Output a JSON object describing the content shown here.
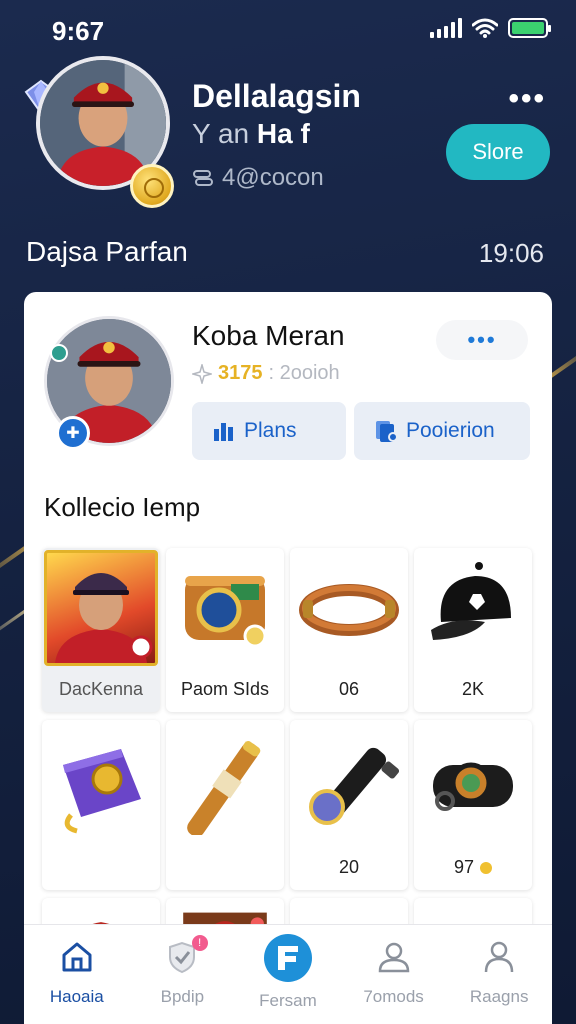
{
  "status_bar": {
    "time": "9:67"
  },
  "header": {
    "name": "Dellalagsin",
    "subtitle_prefix": "Y an",
    "subtitle_bold": "Ha f",
    "meta": "4@cocon",
    "store_label": "Slore",
    "more_label": "•••"
  },
  "section": {
    "title": "Dajsa Parfan",
    "count": "19:06"
  },
  "card": {
    "name": "Koba Meran",
    "meta_gold": "3175",
    "meta_rest": ": 2ooioh",
    "more_label": "•••",
    "plans_label": "Plans",
    "position_label": "Pooierion",
    "collection_title": "Kollecio Iemp"
  },
  "items": [
    {
      "label": "DacKenna",
      "icon": "player-card-icon",
      "selected": true
    },
    {
      "label": "Paom SIds",
      "icon": "wrist-band-icon"
    },
    {
      "label": "06",
      "icon": "leather-ring-icon"
    },
    {
      "label": "2K",
      "icon": "baseball-cap-icon"
    },
    {
      "label": "",
      "icon": "purple-arm-guard-icon"
    },
    {
      "label": "",
      "icon": "baton-icon"
    },
    {
      "label": "20",
      "icon": "flashlight-icon"
    },
    {
      "label": "97",
      "icon": "watch-clasp-icon"
    }
  ],
  "nav": [
    {
      "label": "Haoaia",
      "icon": "home-icon",
      "active": true
    },
    {
      "label": "Bpdip",
      "icon": "badge-check-icon",
      "notif": "!"
    },
    {
      "label": "Fersam",
      "icon": "f-circle-icon"
    },
    {
      "label": "7omods",
      "icon": "user-outline-icon"
    },
    {
      "label": "Raagns",
      "icon": "profile-icon"
    }
  ],
  "colors": {
    "accent": "#22b8c2",
    "primary_blue": "#1b62c9",
    "nav_active": "#1b4fa3",
    "background": "#1b2a4e"
  }
}
